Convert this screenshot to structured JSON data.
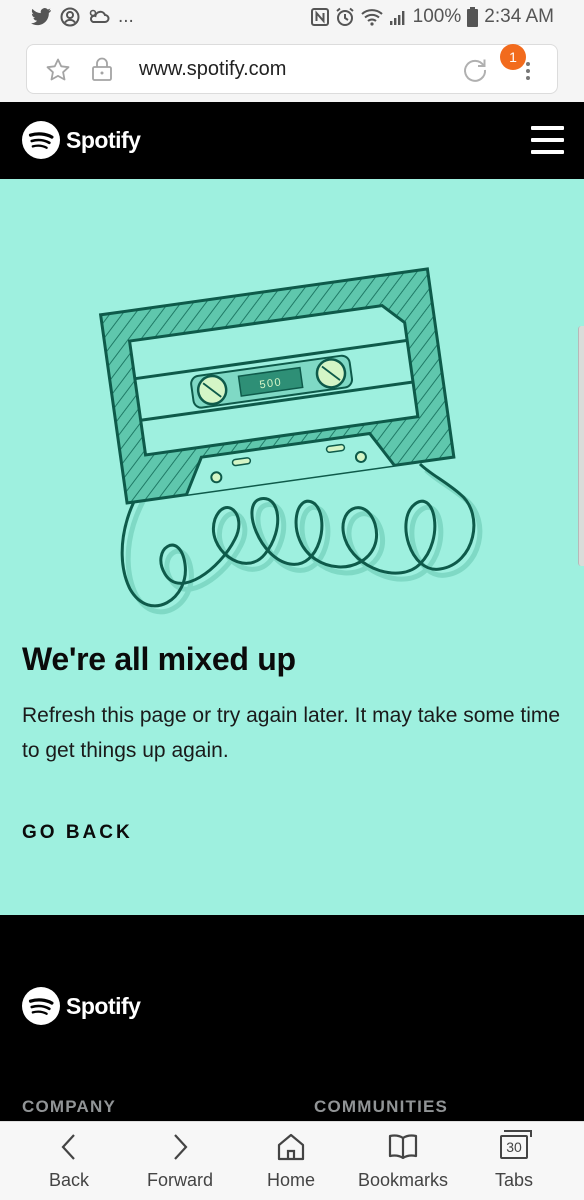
{
  "status_bar": {
    "notifications": "...",
    "battery": "100%",
    "time": "2:34 AM",
    "icons_left": [
      "twitter-icon",
      "account-icon",
      "weather-icon"
    ],
    "icons_right": [
      "nfc-icon",
      "alarm-icon",
      "wifi-icon",
      "signal-icon",
      "battery-icon"
    ]
  },
  "browser": {
    "url": "www.spotify.com",
    "badge_count": "1",
    "badge_color": "#f26b1d"
  },
  "header": {
    "brand": "Spotify",
    "menu_icon": "hamburger-icon"
  },
  "error": {
    "code": "500",
    "title": "We're all mixed up",
    "message": "Refresh this page or try again later. It may take some time to get things up again.",
    "action": "GO BACK",
    "background_color": "#9ef0df",
    "illustration": "cassette-tape-icon"
  },
  "footer": {
    "brand": "Spotify",
    "columns": [
      "COMPANY",
      "COMMUNITIES"
    ]
  },
  "bottom_nav": {
    "items": [
      {
        "label": "Back",
        "icon": "chevron-left-icon"
      },
      {
        "label": "Forward",
        "icon": "chevron-right-icon"
      },
      {
        "label": "Home",
        "icon": "home-icon"
      },
      {
        "label": "Bookmarks",
        "icon": "book-icon"
      },
      {
        "label": "Tabs",
        "icon": "tabs-icon",
        "count": "30"
      }
    ]
  }
}
